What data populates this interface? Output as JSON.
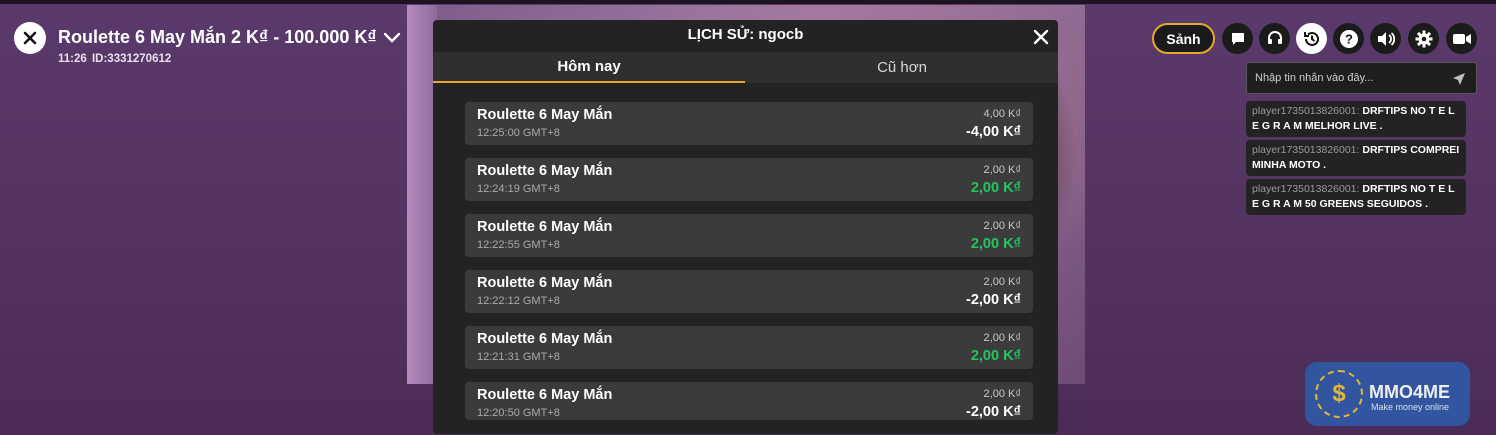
{
  "header": {
    "game_title": "Roulette 6 May Mắn 2 K₫ - 100.000 K₫",
    "meta": "11:26  ID:3331270612",
    "lobby_label": "Sảnh"
  },
  "history": {
    "title": "LỊCH SỬ: ngocb",
    "tabs": [
      {
        "label": "Hôm nay"
      },
      {
        "label": "Cũ hơn"
      }
    ],
    "rows": [
      {
        "name": "Roulette 6 May Mắn",
        "time": "12:25:00 GMT+8",
        "bet": "4,00 K₫",
        "result": "-4,00 K₫"
      },
      {
        "name": "Roulette 6 May Mắn",
        "time": "12:24:19 GMT+8",
        "bet": "2,00 K₫",
        "result": "2,00 K₫"
      },
      {
        "name": "Roulette 6 May Mắn",
        "time": "12:22:55 GMT+8",
        "bet": "2,00 K₫",
        "result": "2,00 K₫"
      },
      {
        "name": "Roulette 6 May Mắn",
        "time": "12:22:12 GMT+8",
        "bet": "2,00 K₫",
        "result": "-2,00 K₫"
      },
      {
        "name": "Roulette 6 May Mắn",
        "time": "12:21:31 GMT+8",
        "bet": "2,00 K₫",
        "result": "2,00 K₫"
      },
      {
        "name": "Roulette 6 May Mắn",
        "time": "12:20:50 GMT+8",
        "bet": "2,00 K₫",
        "result": "-2,00 K₫"
      }
    ]
  },
  "chat": {
    "placeholder": "Nhập tin nhắn vào đây...",
    "messages": [
      {
        "user": "player1735013826001:",
        "text": "DRFTIPS NO T E L E G R A M MELHOR LIVE ."
      },
      {
        "user": "player1735013826001:",
        "text": "DRFTIPS COMPREI MINHA MOTO ."
      },
      {
        "user": "player1735013826001:",
        "text": "DRFTIPS NO T E L E G R A M 50 GREENS SEGUIDOS ."
      }
    ]
  },
  "watermark": {
    "brand": "MMO4ME",
    "tagline": "Make money online",
    "symbol": "$"
  },
  "colors": {
    "accent": "#e8a72a",
    "win": "#22c55e",
    "panel": "#232323",
    "row": "#3b3b3b"
  },
  "icons": [
    "close-icon",
    "chevron-down-icon",
    "chat-icon",
    "headset-icon",
    "history-icon",
    "help-icon",
    "volume-icon",
    "gear-icon",
    "video-icon",
    "send-icon"
  ]
}
